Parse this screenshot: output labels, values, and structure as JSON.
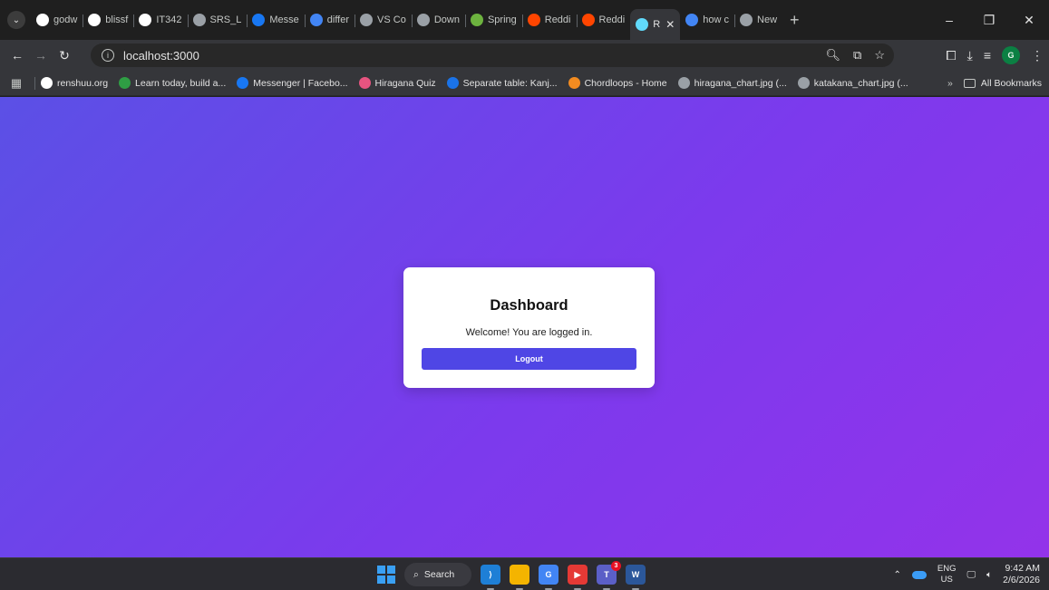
{
  "browser": {
    "tabs": [
      {
        "label": "godw",
        "icon": "github-icon",
        "color": "#ffffff"
      },
      {
        "label": "blissf",
        "icon": "github-icon",
        "color": "#ffffff"
      },
      {
        "label": "IT342",
        "icon": "github-icon",
        "color": "#ffffff"
      },
      {
        "label": "SRS_L",
        "icon": "globe-icon",
        "color": "#9aa0a6"
      },
      {
        "label": "Messe",
        "icon": "facebook-icon",
        "color": "#1877f2"
      },
      {
        "label": "differ",
        "icon": "google-icon",
        "color": "#4285f4"
      },
      {
        "label": "VS Co",
        "icon": "gear-icon",
        "color": "#9aa0a6"
      },
      {
        "label": "Down",
        "icon": "globe-icon",
        "color": "#9aa0a6"
      },
      {
        "label": "Spring",
        "icon": "spring-icon",
        "color": "#6db33f"
      },
      {
        "label": "Reddi",
        "icon": "reddit-icon",
        "color": "#ff4500"
      },
      {
        "label": "Reddi",
        "icon": "reddit-icon",
        "color": "#ff4500"
      },
      {
        "label": "R",
        "icon": "react-icon",
        "color": "#61dafb",
        "active": true
      },
      {
        "label": "how c",
        "icon": "google-icon",
        "color": "#4285f4"
      },
      {
        "label": "New",
        "icon": "globe-icon",
        "color": "#9aa0a6"
      }
    ],
    "url": "localhost:3000",
    "profile_initial": "G",
    "bookmarks": [
      {
        "label": "renshuu.org",
        "icon": "renshuu-icon",
        "color": "#ffffff"
      },
      {
        "label": "Learn today, build a...",
        "icon": "learn-icon",
        "color": "#2f9e44"
      },
      {
        "label": "Messenger | Facebo...",
        "icon": "facebook-icon",
        "color": "#1877f2"
      },
      {
        "label": "Hiragana Quiz",
        "icon": "heart-icon",
        "color": "#e75480"
      },
      {
        "label": "Separate table: Kanj...",
        "icon": "dot-icon",
        "color": "#1a73e8"
      },
      {
        "label": "Chordloops - Home",
        "icon": "headphones-icon",
        "color": "#f28b20"
      },
      {
        "label": "hiragana_chart.jpg (...",
        "icon": "globe-icon",
        "color": "#9aa0a6"
      },
      {
        "label": "katakana_chart.jpg (...",
        "icon": "globe-icon",
        "color": "#9aa0a6"
      }
    ],
    "all_bookmarks_label": "All Bookmarks"
  },
  "app": {
    "title": "Dashboard",
    "message": "Welcome! You are logged in.",
    "logout_label": "Logout",
    "gradient_start": "#5b50e6",
    "gradient_end": "#9333ea",
    "button_color": "#4f46e5"
  },
  "taskbar": {
    "search_label": "Search",
    "lang_top": "ENG",
    "lang_bottom": "US",
    "time": "9:42 AM",
    "date": "2/6/2026",
    "teams_badge": "3"
  }
}
